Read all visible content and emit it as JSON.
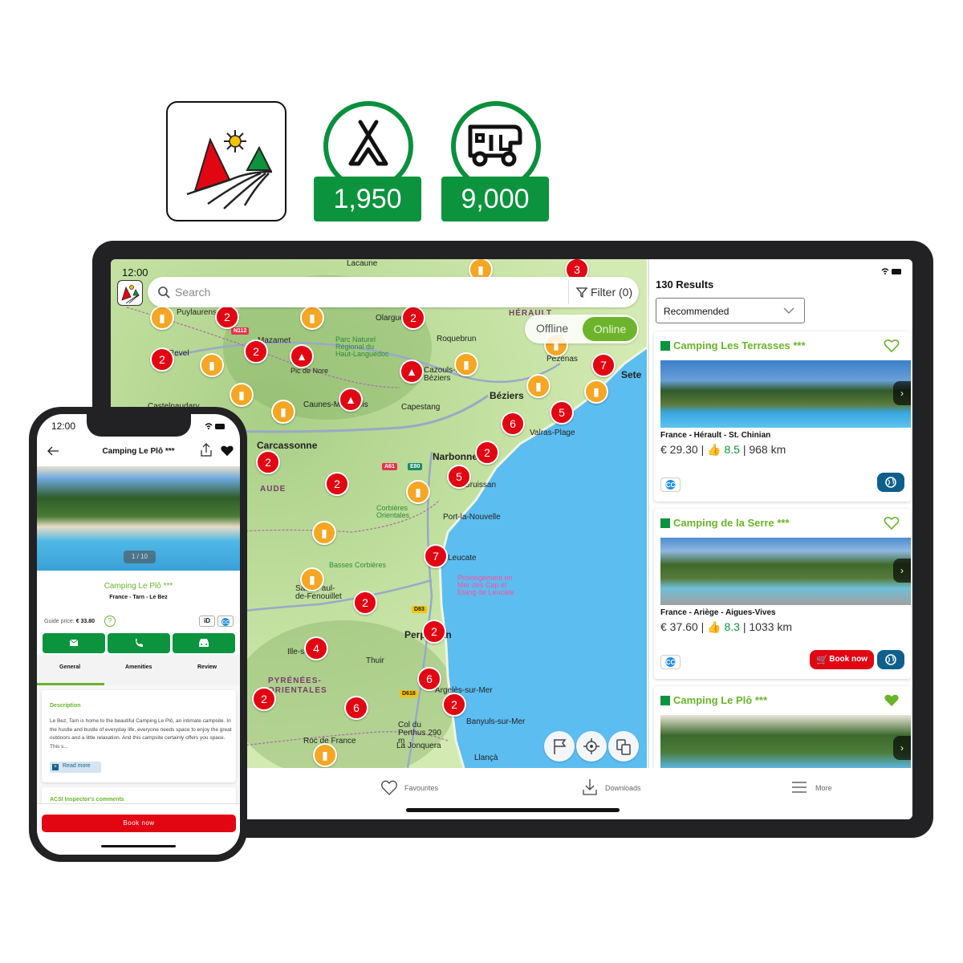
{
  "badges": {
    "logo": "acsi-logo-icon",
    "campsites": {
      "icon": "tent-icon",
      "value": "1,950"
    },
    "motorhome": {
      "icon": "motorhome-icon",
      "value": "9,000"
    }
  },
  "colors": {
    "brand_green": "#0b943d",
    "accent_green": "#6ab42a",
    "red": "#e20613",
    "orange": "#f5a623",
    "web_blue": "#0f5f8c"
  },
  "tablet": {
    "status_time": "12:00",
    "search": {
      "placeholder": "Search",
      "filter_label": "Filter (0)"
    },
    "mode_toggle": {
      "offline": "Offline",
      "online": "Online",
      "selected": "Online"
    },
    "map": {
      "cities": [
        {
          "name": "Lacaune"
        },
        {
          "name": "Mazamet"
        },
        {
          "name": "Olargue"
        },
        {
          "name": "Roquebrun"
        },
        {
          "name": "HÉRAULT"
        },
        {
          "name": "Parc Naturel Régional du Haut-Languedoc"
        },
        {
          "name": "Pic de Nore"
        },
        {
          "name": "Cazouls-lès-Béziers"
        },
        {
          "name": "Pézenas"
        },
        {
          "name": "Sete"
        },
        {
          "name": "Béziers"
        },
        {
          "name": "Caunes-Minervois"
        },
        {
          "name": "Capestang"
        },
        {
          "name": "Valras-Plage"
        },
        {
          "name": "Carcassonne"
        },
        {
          "name": "Narbonne"
        },
        {
          "name": "Gruissan"
        },
        {
          "name": "AUDE"
        },
        {
          "name": "Corbières Orientales"
        },
        {
          "name": "Port-la-Nouvelle"
        },
        {
          "name": "Leucate"
        },
        {
          "name": "Basses Corbières"
        },
        {
          "name": "Prolongement en Mer des Cap et Etang de Leucate"
        },
        {
          "name": "Saint-Paul-de-Fenouillet"
        },
        {
          "name": "Perpignan"
        },
        {
          "name": "Ille-sur-Têt"
        },
        {
          "name": "Thuir"
        },
        {
          "name": "PYRÉNÉES-ORIENTALES"
        },
        {
          "name": "Argelès-sur-Mer"
        },
        {
          "name": "Banyuls-sur-Mer"
        },
        {
          "name": "Col du Perthus 290 m"
        },
        {
          "name": "Roc de France"
        },
        {
          "name": "La Jonquera"
        },
        {
          "name": "Llançà"
        },
        {
          "name": "Castelnaudary"
        },
        {
          "name": "Puylaurens"
        },
        {
          "name": "Revel"
        }
      ],
      "road_labels": [
        "N112",
        "A61",
        "E80",
        "D83",
        "D618"
      ],
      "clusters": [
        "3",
        "2",
        "2",
        "2",
        "2",
        "7",
        "5",
        "6",
        "2",
        "5",
        "2",
        "2",
        "7",
        "2",
        "2",
        "4",
        "6",
        "2",
        "2",
        "6"
      ]
    },
    "map_buttons": [
      "flag-icon",
      "locate-icon",
      "layers-icon"
    ],
    "results": {
      "count_label": "130 Results",
      "sort": "Recommended",
      "items": [
        {
          "name": "Camping Les Terrasses ***",
          "location": "France  - Hérault - St. Chinian",
          "price": "€ 29.30",
          "rating": "8.5",
          "distance": "968 km",
          "favourite": false,
          "book_now": null
        },
        {
          "name": "Camping de la Serre ***",
          "location": "France  - Ariège - Aigues-Vives",
          "price": "€ 37.60",
          "rating": "8.3",
          "distance": "1033 km",
          "favourite": false,
          "book_now": "Book now"
        },
        {
          "name": "Camping Le Plô ***",
          "location": "",
          "price": "",
          "rating": "",
          "distance": "",
          "favourite": true,
          "book_now": null
        }
      ]
    },
    "bottom_nav": {
      "favourites": "Favourites",
      "downloads": "Downloads",
      "more": "More"
    }
  },
  "phone": {
    "status_time": "12:00",
    "title": "Camping Le Plô ***",
    "photo_counter": "1 / 10",
    "name": "Camping Le Plô ***",
    "location": "France  - Tarn - Le Bez",
    "guide_price_label": "Guide price:",
    "guide_price": "€ 33.80",
    "id_badge": "iD",
    "tabs": [
      "General",
      "Amenities",
      "Review"
    ],
    "active_tab": "General",
    "description": {
      "heading": "Description",
      "text": "Le Bez, Tarn is home to the beautiful Camping Le Plô, an intimate campsite. In the hustle and bustle of everyday life, everyone needs space to enjoy the great outdoors and a little relaxation. And this campsite certainly offers you space. This s...",
      "read_more": "Read more"
    },
    "inspector_heading": "ACSI Inspector's comments",
    "book_now": "Book now"
  }
}
